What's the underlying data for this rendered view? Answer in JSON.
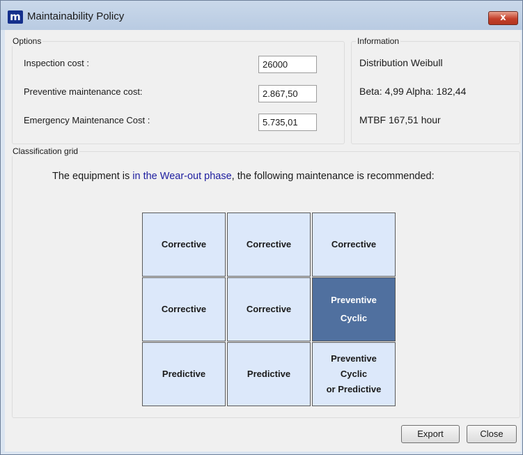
{
  "window": {
    "title": "Maintainability Policy",
    "app_icon_letter": "m",
    "close_glyph": "x"
  },
  "options": {
    "title": "Options",
    "fields": [
      {
        "label": "Inspection cost :",
        "value": "26000"
      },
      {
        "label": "Preventive maintenance cost:",
        "value": "2.867,50"
      },
      {
        "label": "Emergency Maintenance Cost :",
        "value": "5.735,01"
      }
    ]
  },
  "information": {
    "title": "Information",
    "lines": [
      "Distribution Weibull",
      "Beta: 4,99 Alpha: 182,44",
      "MTBF 167,51 hour"
    ]
  },
  "classification": {
    "title": "Classification grid",
    "sentence_before": "The equipment is ",
    "sentence_highlight": "in the Wear-out phase",
    "sentence_after": ", the following maintenance is recommended:",
    "grid": [
      [
        [
          "Corrective"
        ],
        [
          "Corrective"
        ],
        [
          "Corrective"
        ]
      ],
      [
        [
          "Corrective"
        ],
        [
          "Corrective"
        ],
        [
          "Preventive",
          "Cyclic"
        ]
      ],
      [
        [
          "Predictive"
        ],
        [
          "Predictive"
        ],
        [
          "Preventive",
          "Cyclic",
          "or Predictive"
        ]
      ]
    ],
    "selected": "row 2, column 3"
  },
  "buttons": {
    "export": "Export",
    "close": "Close"
  },
  "colors": {
    "selected_cell": "#50709f",
    "cell": "#dce8fa",
    "highlight_text": "#2020a0"
  }
}
